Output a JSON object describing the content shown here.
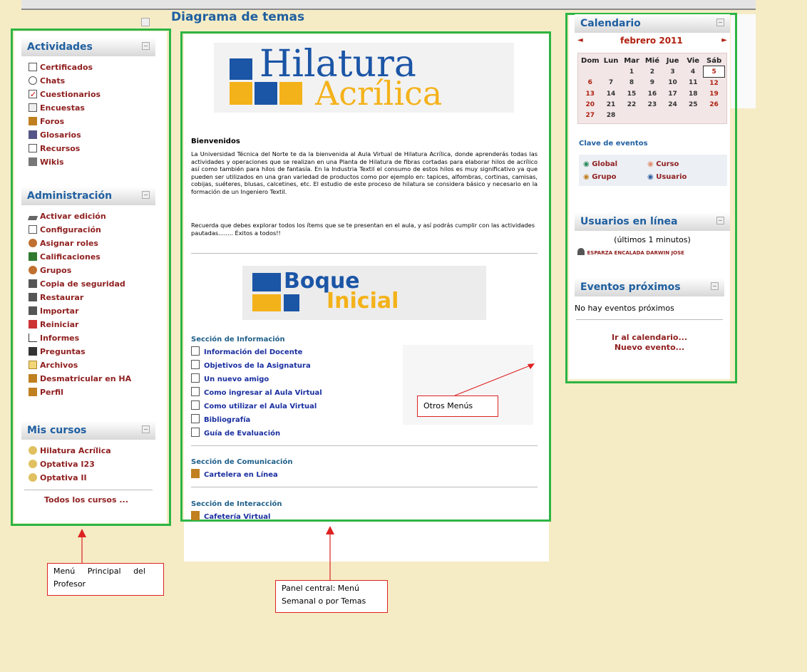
{
  "page": {
    "title": "Diagrama de temas"
  },
  "activities": {
    "title": "Actividades",
    "items": [
      {
        "label": "Certificados",
        "icon": "certificate-icon"
      },
      {
        "label": "Chats",
        "icon": "chat-icon"
      },
      {
        "label": "Cuestionarios",
        "icon": "quiz-icon"
      },
      {
        "label": "Encuestas",
        "icon": "survey-icon"
      },
      {
        "label": "Foros",
        "icon": "forum-icon"
      },
      {
        "label": "Glosarios",
        "icon": "glossary-icon"
      },
      {
        "label": "Recursos",
        "icon": "resource-icon"
      },
      {
        "label": "Wikis",
        "icon": "wiki-icon"
      }
    ]
  },
  "admin": {
    "title": "Administración",
    "items": [
      {
        "label": "Activar edición",
        "icon": "pencil-icon"
      },
      {
        "label": "Configuración",
        "icon": "settings-icon"
      },
      {
        "label": "Asignar roles",
        "icon": "roles-icon"
      },
      {
        "label": "Calificaciones",
        "icon": "grades-icon"
      },
      {
        "label": "Grupos",
        "icon": "groups-icon"
      },
      {
        "label": "Copia de seguridad",
        "icon": "backup-icon"
      },
      {
        "label": "Restaurar",
        "icon": "restore-icon"
      },
      {
        "label": "Importar",
        "icon": "import-icon"
      },
      {
        "label": "Reiniciar",
        "icon": "reset-icon"
      },
      {
        "label": "Informes",
        "icon": "reports-icon"
      },
      {
        "label": "Preguntas",
        "icon": "questions-icon"
      },
      {
        "label": "Archivos",
        "icon": "folder-icon"
      },
      {
        "label": "Desmatricular en HA",
        "icon": "unenrol-icon"
      },
      {
        "label": "Perfil",
        "icon": "profile-icon"
      }
    ]
  },
  "courses": {
    "title": "Mis cursos",
    "items": [
      {
        "label": "Hilatura Acrílica"
      },
      {
        "label": "Optativa I23"
      },
      {
        "label": "Optativa II"
      }
    ],
    "all_link": "Todos los cursos ..."
  },
  "center": {
    "logo_line1": "Hilatura",
    "logo_line2": "Acrílica",
    "welcome_title": "Bienvenidos",
    "welcome_p1": "La Universidad Técnica del Norte te da la bienvenida al Aula Virtual de Hilatura Acrílica, donde aprenderás todas las actividades y operaciones que se realizan en una Planta de Hilatura de fibras cortadas para elaborar hilos de acrílico así como también para hilos de fantasía. En la Industria Textil el consumo de estos hilos es muy significativo ya que pueden ser utilizados en una gran variedad de productos como por ejemplo en: tapices, alfombras, cortinas, camisas, cobijas, suéteres, blusas, calcetines, etc. El estudio de este proceso de hilatura se considera básico y necesario en la formación de un Ingeniero Textil.",
    "welcome_p2": "Recuerda que debes explorar todos los ítems que se te presentan en el aula, y así podrás cumplir con las actividades pautadas........ Éxitos a todos!!",
    "block_line1": "Boque",
    "block_line2": "Inicial",
    "sec_info": "Sección de Información",
    "info_items": [
      "Información del Docente",
      "Objetivos de la Asignatura",
      "Un nuevo amigo",
      "Como ingresar al Aula Virtual",
      "Como utilizar el Aula Virtual",
      "Bibliografía",
      "Guía de Evaluación"
    ],
    "sec_comm": "Sección de Comunicación",
    "comm_items": [
      "Cartelera en Línea"
    ],
    "sec_inter": "Sección de Interacción",
    "inter_items": [
      "Cafetería Virtual"
    ]
  },
  "calendar": {
    "title": "Calendario",
    "month": "febrero 2011",
    "days": [
      "Dom",
      "Lun",
      "Mar",
      "Mié",
      "Jue",
      "Vie",
      "Sáb"
    ],
    "weeks": [
      [
        "",
        "",
        "1",
        "2",
        "3",
        "4",
        "5"
      ],
      [
        "6",
        "7",
        "8",
        "9",
        "10",
        "11",
        "12"
      ],
      [
        "13",
        "14",
        "15",
        "16",
        "17",
        "18",
        "19"
      ],
      [
        "20",
        "21",
        "22",
        "23",
        "24",
        "25",
        "26"
      ],
      [
        "27",
        "28",
        "",
        "",
        "",
        "",
        ""
      ]
    ],
    "today": "5",
    "events_key_title": "Clave de eventos",
    "key_global": "Global",
    "key_course": "Curso",
    "key_group": "Grupo",
    "key_user": "Usuario"
  },
  "online": {
    "title": "Usuarios en línea",
    "subtitle": "(últimos 1 minutos)",
    "user": "ESPARZA ENCALADA DARWIN JOSE"
  },
  "upcoming": {
    "title": "Eventos próximos",
    "empty": "No hay eventos próximos",
    "link_calendar": "Ir al calendario...",
    "link_new": "Nuevo evento..."
  },
  "annotations": {
    "other_menus": "Otros Menús",
    "teacher_menu": "Menú Principal del Profesor",
    "central_panel": "Panel central: Menú Semanal o por Temas"
  },
  "colors": {
    "green": "#2db544",
    "link": "#902020",
    "heading": "#1f5fa0"
  }
}
